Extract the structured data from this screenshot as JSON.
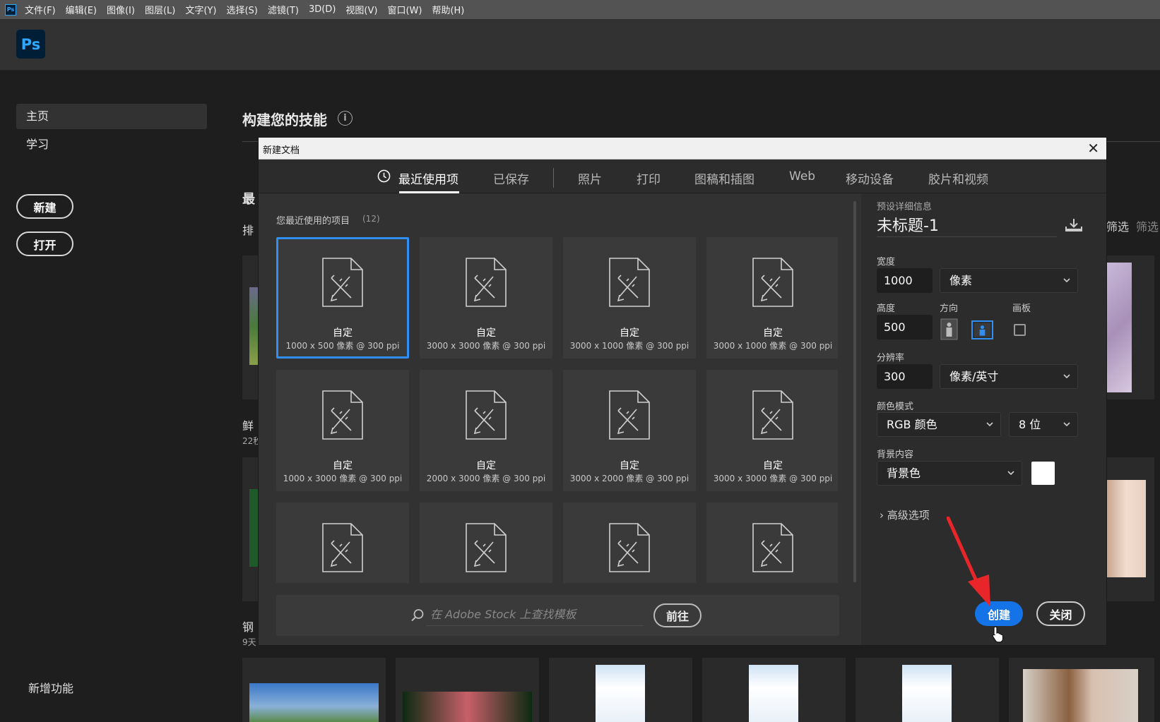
{
  "app": {
    "icon_text": "Ps",
    "logo_text": "Ps"
  },
  "menu": [
    "文件(F)",
    "编辑(E)",
    "图像(I)",
    "图层(L)",
    "文字(Y)",
    "选择(S)",
    "滤镜(T)",
    "3D(D)",
    "视图(V)",
    "窗口(W)",
    "帮助(H)"
  ],
  "sidebar": {
    "home": "主页",
    "learn": "学习",
    "new_button": "新建",
    "open_button": "打开",
    "new_features": "新增功能"
  },
  "home": {
    "title": "构建您的技能",
    "info_icon": "i",
    "recent_fragment": "最",
    "sort_fragment": "排",
    "filter_partial_1": "筛选",
    "filter_partial_2": "筛选",
    "file1_name_fragment": "鲜",
    "file1_age_fragment": "22秒",
    "file2_name_fragment": "钢",
    "file2_age_fragment": "9天"
  },
  "dialog": {
    "title": "新建文档",
    "close_glyph": "✕",
    "tabs": [
      "最近使用项",
      "已保存",
      "照片",
      "打印",
      "图稿和插图",
      "Web",
      "移动设备",
      "胶片和视频"
    ],
    "active_tab": 0,
    "recent_label": "您最近使用的项目",
    "recent_count": "(12)",
    "presets": [
      {
        "title": "自定",
        "detail": "1000 x 500 像素 @ 300 ppi"
      },
      {
        "title": "自定",
        "detail": "3000 x 3000 像素 @ 300 ppi"
      },
      {
        "title": "自定",
        "detail": "3000 x 1000 像素 @ 300 ppi"
      },
      {
        "title": "自定",
        "detail": "3000 x 1000 像素 @ 300 ppi"
      },
      {
        "title": "自定",
        "detail": "1000 x 3000 像素 @ 300 ppi"
      },
      {
        "title": "自定",
        "detail": "2000 x 3000 像素 @ 300 ppi"
      },
      {
        "title": "自定",
        "detail": "3000 x 2000 像素 @ 300 ppi"
      },
      {
        "title": "自定",
        "detail": "3000 x 3000 像素 @ 300 ppi"
      },
      {
        "title": "",
        "detail": ""
      },
      {
        "title": "",
        "detail": ""
      },
      {
        "title": "",
        "detail": ""
      },
      {
        "title": "",
        "detail": ""
      }
    ],
    "stock": {
      "placeholder": "在 Adobe Stock 上查找模板",
      "go_button": "前往"
    },
    "details": {
      "header": "预设详细信息",
      "doc_name": "未标题-1",
      "width_label": "宽度",
      "width_value": "1000",
      "width_unit": "像素",
      "height_label": "高度",
      "height_value": "500",
      "orientation_label": "方向",
      "artboard_label": "画板",
      "artboard_checked": false,
      "resolution_label": "分辨率",
      "resolution_value": "300",
      "resolution_unit": "像素/英寸",
      "color_mode_label": "颜色模式",
      "color_mode": "RGB 颜色",
      "bit_depth": "8 位",
      "background_label": "背景内容",
      "background": "背景色",
      "background_color": "#ffffff",
      "advanced": "高级选项",
      "create_button": "创建",
      "close_button": "关闭"
    }
  },
  "colors": {
    "accent": "#1473e6",
    "selection": "#2f8ff5",
    "annotation_arrow": "#e8262a"
  }
}
